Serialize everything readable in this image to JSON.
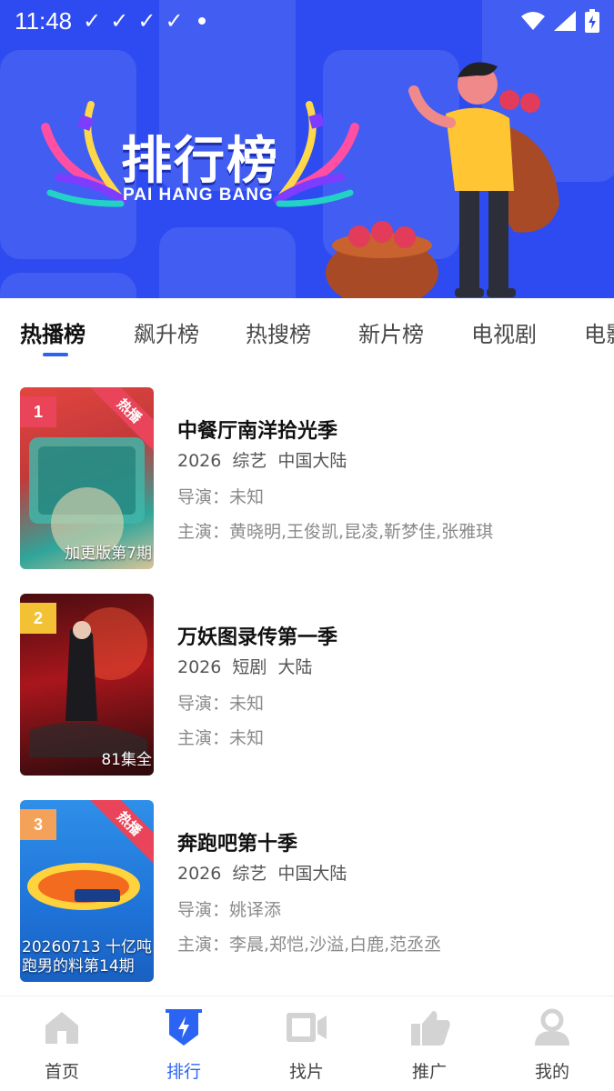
{
  "status_bar": {
    "time": "11:48"
  },
  "hero": {
    "title": "排行榜",
    "subtitle": "PAI HANG BANG"
  },
  "tabs": [
    {
      "label": "热播榜",
      "active": true
    },
    {
      "label": "飙升榜",
      "active": false
    },
    {
      "label": "热搜榜",
      "active": false
    },
    {
      "label": "新片榜",
      "active": false
    },
    {
      "label": "电视剧",
      "active": false
    },
    {
      "label": "电影",
      "active": false
    }
  ],
  "items": [
    {
      "rank": "1",
      "rank_color": "#e9445a",
      "hot_badge": "热播",
      "poster_caption": "加更版第7期",
      "title": "中餐厅南洋拾光季",
      "year": "2026",
      "genre": "综艺",
      "region": "中国大陆",
      "director": "导演：未知",
      "cast": "主演：黄晓明,王俊凯,昆凌,靳梦佳,张雅琪"
    },
    {
      "rank": "2",
      "rank_color": "#f3c234",
      "hot_badge": "",
      "poster_caption": "81集全",
      "title": "万妖图录传第一季",
      "year": "2026",
      "genre": "短剧",
      "region": "大陆",
      "director": "导演：未知",
      "cast": "主演：未知"
    },
    {
      "rank": "3",
      "rank_color": "#f4a15a",
      "hot_badge": "热播",
      "poster_caption": "20260713 十亿吨跑男的料第14期",
      "title": "奔跑吧第十季",
      "year": "2026",
      "genre": "综艺",
      "region": "中国大陆",
      "director": "导演：姚译添",
      "cast": "主演：李晨,郑恺,沙溢,白鹿,范丞丞"
    }
  ],
  "bottom_nav": [
    {
      "label": "首页",
      "icon": "home-icon",
      "active": false
    },
    {
      "label": "排行",
      "icon": "ranking-icon",
      "active": true
    },
    {
      "label": "找片",
      "icon": "video-camera-icon",
      "active": false
    },
    {
      "label": "推广",
      "icon": "thumbs-up-icon",
      "active": false
    },
    {
      "label": "我的",
      "icon": "user-icon",
      "active": false
    }
  ],
  "colors": {
    "hero_bg": "#2d4bf0",
    "accent": "#2b63f3",
    "hot": "#e9445a"
  }
}
